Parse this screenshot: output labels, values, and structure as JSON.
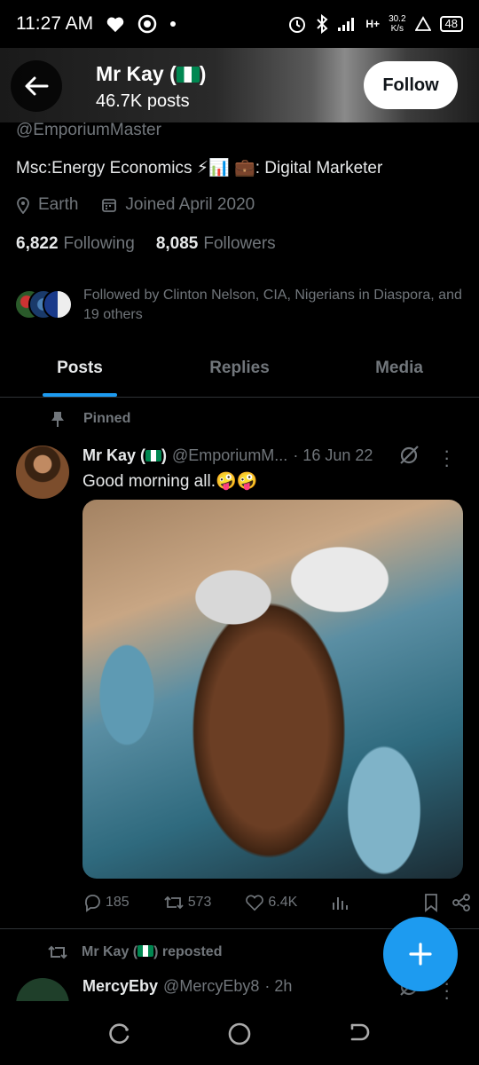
{
  "status_bar": {
    "time": "11:27 AM",
    "speed_value": "30.2",
    "speed_unit": "K/s",
    "network": "H+",
    "battery": "48"
  },
  "header": {
    "name": "Mr Kay (",
    "name_close": ")",
    "posts": "46.7K posts",
    "follow_label": "Follow"
  },
  "profile": {
    "handle": "@EmporiumMaster",
    "bio": "Msc:Energy Economics ⚡📊   💼: Digital  Marketer",
    "location": "Earth",
    "joined": "Joined April 2020",
    "following_count": "6,822",
    "following_label": "Following",
    "followers_count": "8,085",
    "followers_label": "Followers",
    "followed_by": "Followed by Clinton Nelson, CIA, Nigerians in Diaspora, and 19 others"
  },
  "tabs": [
    {
      "label": "Posts"
    },
    {
      "label": "Replies"
    },
    {
      "label": "Media"
    }
  ],
  "pinned_post": {
    "pinned_label": "Pinned",
    "author": "Mr Kay (",
    "author_close": ")",
    "handle": "@EmporiumM...",
    "date": "· 16 Jun 22",
    "text": "Good morning all.🤪🤪",
    "replies": "185",
    "reposts": "573",
    "likes": "6.4K"
  },
  "second_post": {
    "repost_label_start": "Mr Kay (",
    "repost_label_end": ") reposted",
    "author": "MercyEby",
    "handle": "@MercyEby8",
    "time": "· 2h"
  },
  "colors": {
    "accent": "#1d9bf0",
    "muted": "#71767b",
    "text": "#e7e9ea",
    "background": "#000000"
  }
}
